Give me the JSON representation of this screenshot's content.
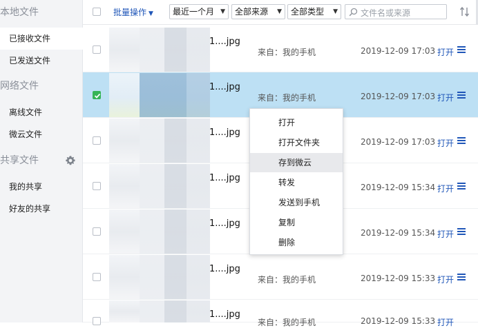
{
  "sidebar": {
    "sections": [
      {
        "title": "本地文件",
        "items": [
          "已接收文件",
          "已发送文件"
        ]
      },
      {
        "title": "网络文件",
        "items": [
          "离线文件",
          "微云文件"
        ]
      },
      {
        "title": "共享文件",
        "items": [
          "我的共享",
          "好友的共享"
        ]
      }
    ],
    "active_item": "已接收文件",
    "settings_icon": "gear-icon"
  },
  "toolbar": {
    "batch_label": "批量操作",
    "filters": [
      "最近一个月",
      "全部来源",
      "全部类型"
    ],
    "search_placeholder": "文件名或来源",
    "sort_icon": "sort-icon"
  },
  "files": [
    {
      "name": "1....jpg",
      "source": "来自：我的手机",
      "time": "2019-12-09 17:03",
      "action": "打开",
      "selected": false
    },
    {
      "name": "1....jpg",
      "source": "来自：我的手机",
      "time": "2019-12-09 17:03",
      "action": "打开",
      "selected": true
    },
    {
      "name": "1....jpg",
      "source": "",
      "time": "2019-12-09 17:03",
      "action": "打开",
      "selected": false
    },
    {
      "name": "1....jpg",
      "source": "",
      "time": "2019-12-09 15:34",
      "action": "打开",
      "selected": false
    },
    {
      "name": "1....jpg",
      "source": "",
      "time": "2019-12-09 15:34",
      "action": "打开",
      "selected": false
    },
    {
      "name": "1....jpg",
      "source": "来自：我的手机",
      "time": "2019-12-09 15:33",
      "action": "打开",
      "selected": false
    },
    {
      "name": "1....jpg",
      "source": "来自：我的手机",
      "time": "2019-12-09 15:33",
      "action": "打开",
      "selected": false
    }
  ],
  "context_menu": {
    "items": [
      "打开",
      "打开文件夹",
      "存到微云",
      "转发",
      "发送到手机",
      "复制",
      "删除"
    ],
    "hovered": "存到微云"
  },
  "colors": {
    "accent": "#1f56b8",
    "selected_row": "#bde0f4",
    "checkbox_checked": "#35b456"
  }
}
